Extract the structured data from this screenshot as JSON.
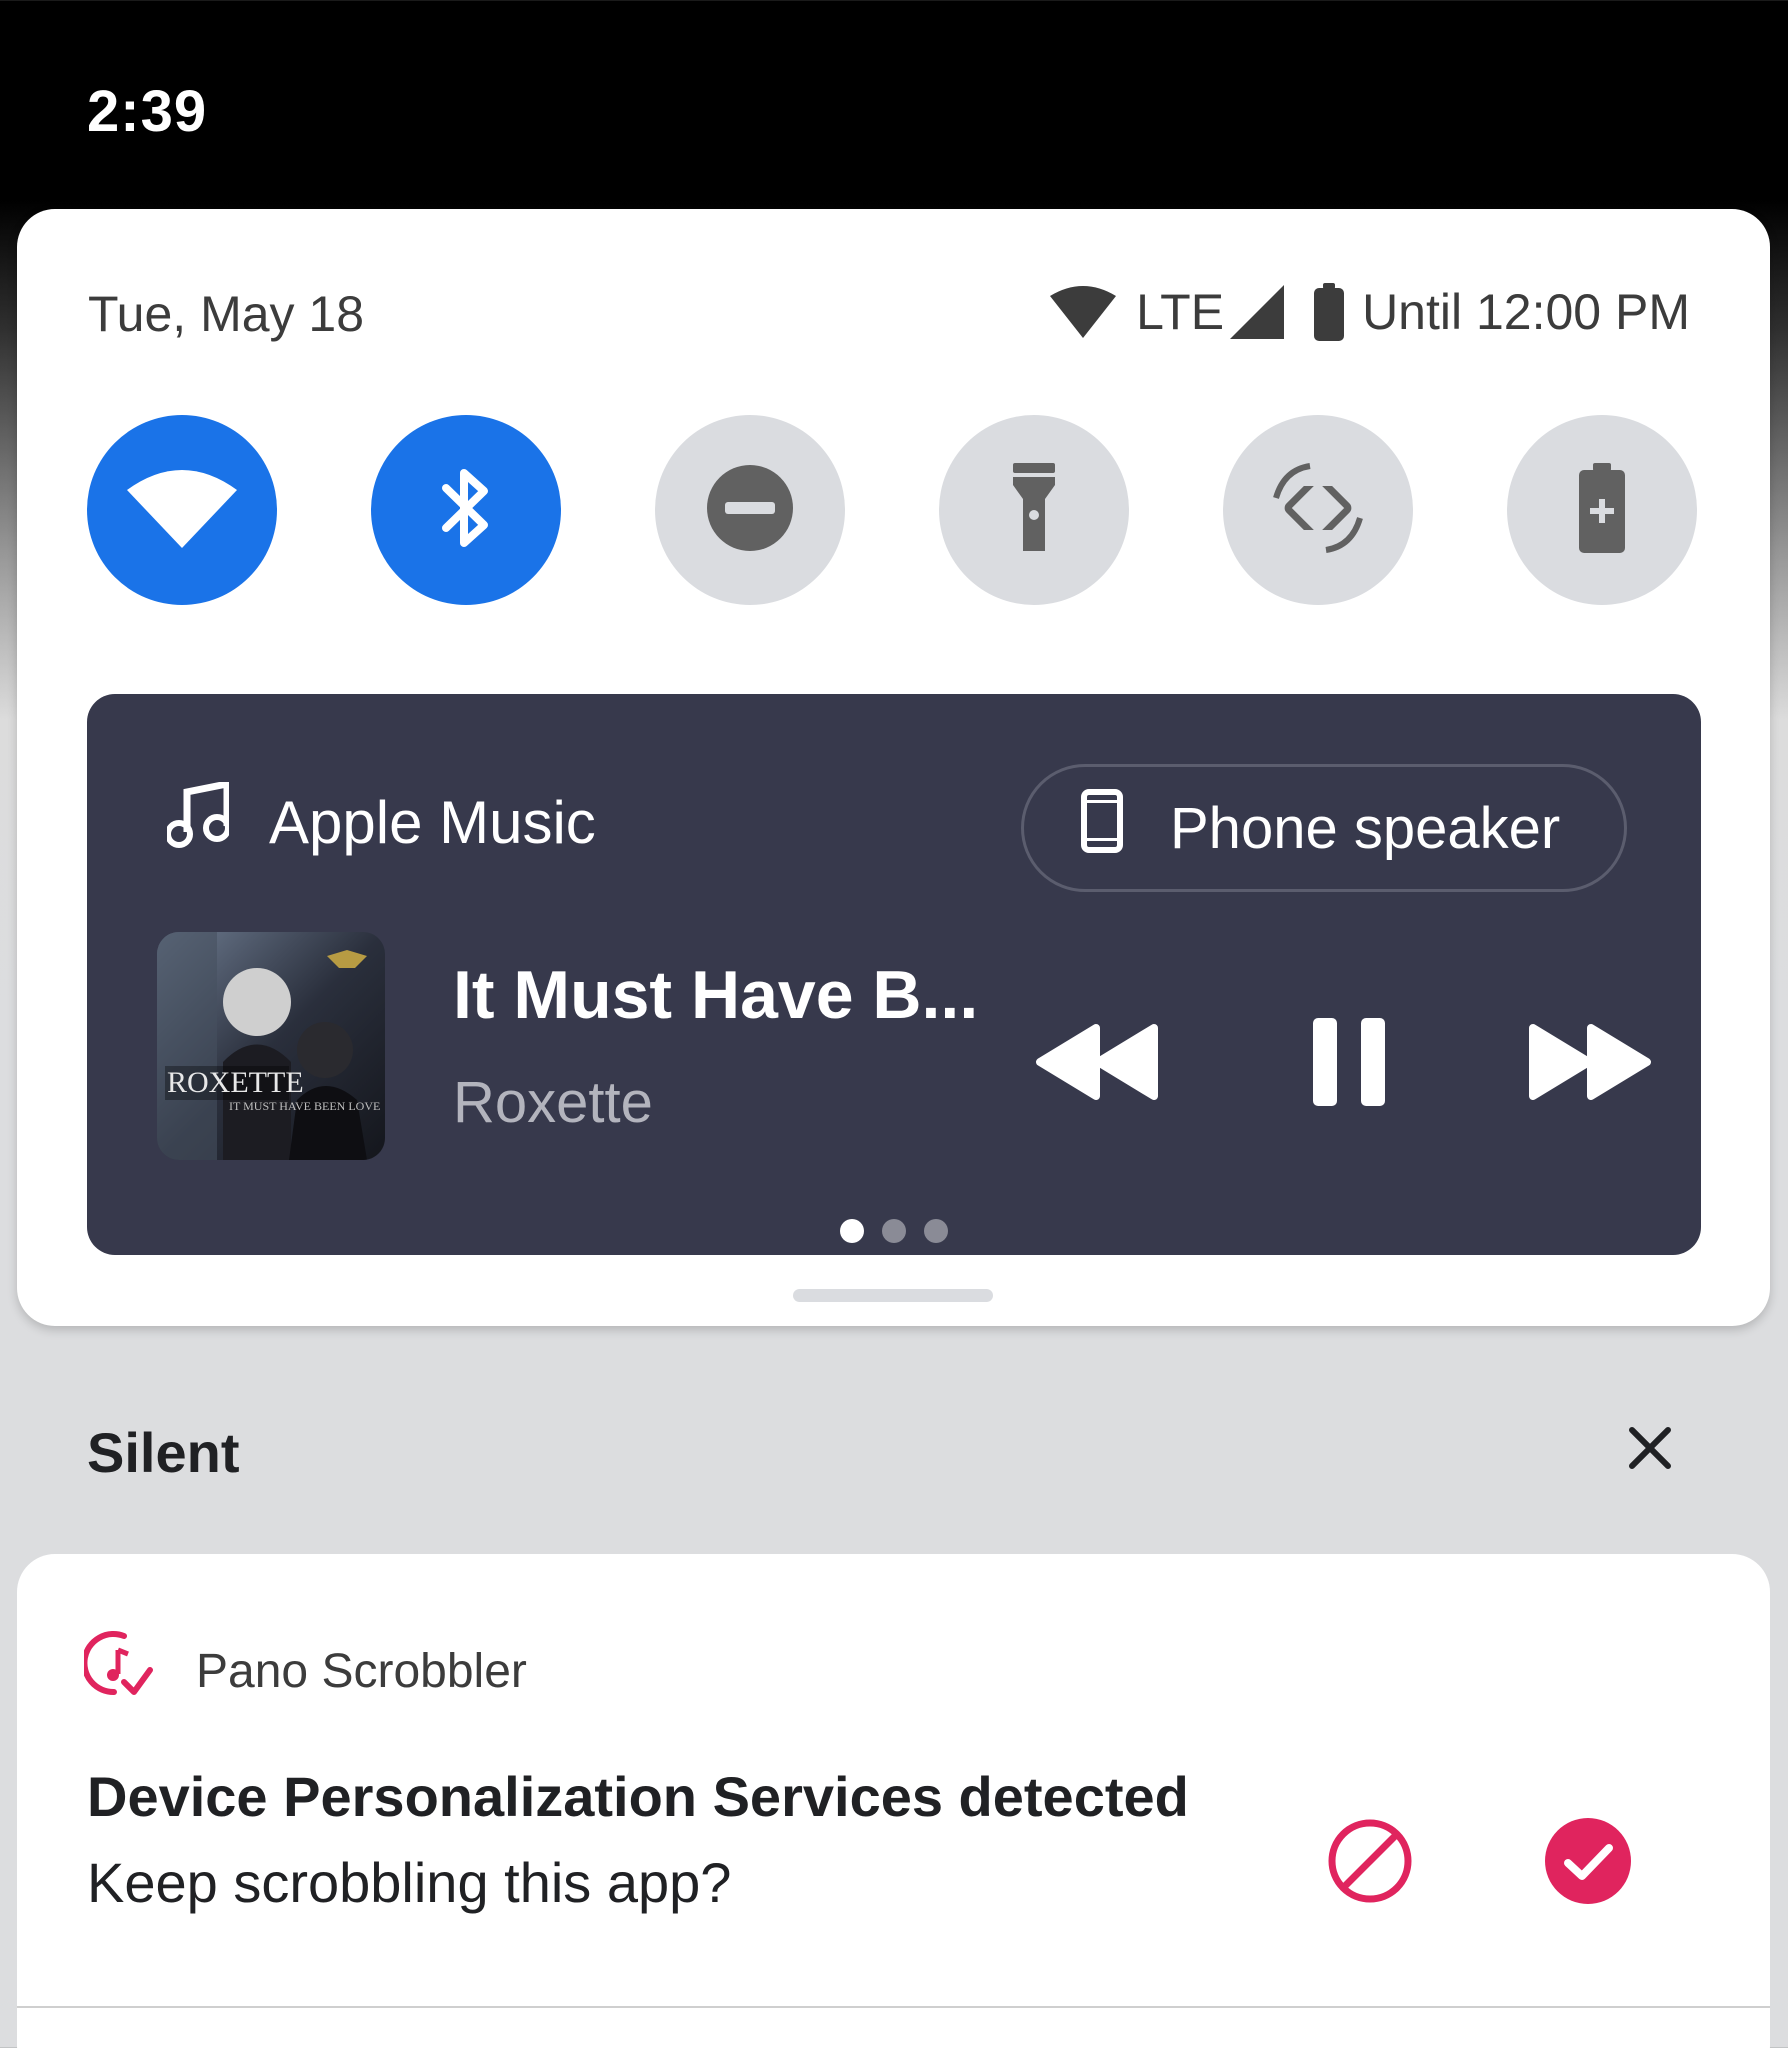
{
  "status_bar": {
    "time": "2:39"
  },
  "quick_settings": {
    "date": "Tue, May 18",
    "network_label": "LTE",
    "battery_text": "Until 12:00 PM",
    "tiles": [
      {
        "name": "Wi-Fi",
        "icon": "wifi-icon",
        "state": "on"
      },
      {
        "name": "Bluetooth",
        "icon": "bluetooth-icon",
        "state": "on"
      },
      {
        "name": "Do Not Disturb",
        "icon": "dnd-icon",
        "state": "off"
      },
      {
        "name": "Flashlight",
        "icon": "flashlight-icon",
        "state": "off"
      },
      {
        "name": "Auto-rotate",
        "icon": "auto-rotate-icon",
        "state": "off"
      },
      {
        "name": "Battery Saver",
        "icon": "battery-saver-icon",
        "state": "off"
      }
    ]
  },
  "media": {
    "app_name": "Apple Music",
    "output_device": "Phone speaker",
    "track_title": "It Must Have B...",
    "artist": "Roxette",
    "album_art_text": "ROXETTE",
    "album_art_subtext": "IT MUST HAVE BEEN LOVE",
    "page_count": 3,
    "active_page": 0
  },
  "notifications": {
    "section_title": "Silent",
    "items": [
      {
        "app_name": "Pano Scrobbler",
        "title": "Device Personalization Services detected",
        "text": "Keep scrobbling this app?",
        "actions": [
          "block-icon",
          "check-icon"
        ]
      }
    ]
  },
  "colors": {
    "accent": "#1a73e8",
    "tile_off": "#dadce0",
    "media_bg": "#37394c",
    "app_accent": "#e0245e"
  }
}
